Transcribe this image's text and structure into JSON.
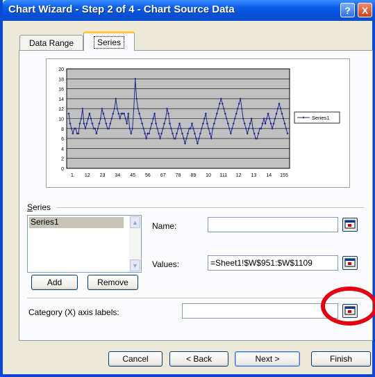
{
  "window": {
    "title": "Chart Wizard - Step 2 of 4 - Chart Source Data",
    "help": "?",
    "close": "X"
  },
  "tabs": [
    "Data Range",
    "Series"
  ],
  "chart_data": {
    "type": "line",
    "title": "",
    "ylim": [
      0,
      20
    ],
    "yticks": [
      0,
      2,
      4,
      6,
      8,
      10,
      12,
      14,
      16,
      18,
      20
    ],
    "x_tick_labels": [
      "1",
      "12",
      "23",
      "34",
      "45",
      "56",
      "67",
      "78",
      "89",
      "10",
      "111",
      "12",
      "13",
      "14",
      "155"
    ],
    "grid": true,
    "legend_position": "right",
    "series": [
      {
        "name": "Series1",
        "values": [
          11,
          9,
          8,
          7,
          8,
          8,
          7,
          7,
          9,
          10,
          12,
          9,
          8,
          9,
          10,
          11,
          10,
          9,
          8,
          8,
          7,
          8,
          9,
          10,
          12,
          11,
          10,
          9,
          8,
          8,
          9,
          10,
          11,
          12,
          14,
          12,
          11,
          10,
          11,
          11,
          11,
          10,
          9,
          11,
          8,
          7,
          8,
          12,
          18,
          14,
          12,
          11,
          10,
          9,
          8,
          7,
          6,
          7,
          7,
          8,
          9,
          10,
          11,
          9,
          8,
          7,
          6,
          7,
          8,
          9,
          10,
          12,
          11,
          9,
          8,
          7,
          6,
          6,
          7,
          8,
          9,
          8,
          7,
          6,
          5,
          6,
          7,
          8,
          8,
          9,
          8,
          7,
          6,
          5,
          6,
          7,
          8,
          9,
          10,
          11,
          9,
          8,
          7,
          6,
          8,
          9,
          10,
          11,
          12,
          13,
          14,
          13,
          12,
          11,
          10,
          9,
          8,
          7,
          8,
          9,
          10,
          11,
          12,
          13,
          14,
          12,
          10,
          9,
          8,
          7,
          8,
          9,
          10,
          8,
          7,
          6,
          6,
          7,
          8,
          8,
          9,
          10,
          9,
          10,
          11,
          10,
          9,
          8,
          9,
          10,
          11,
          12,
          13,
          12,
          11,
          10,
          9,
          8,
          7
        ]
      }
    ]
  },
  "series_section": {
    "label": "Series",
    "list_items": [
      "Series1"
    ],
    "add_button": "Add",
    "remove_button": "Remove"
  },
  "fields": {
    "name_label": "Name:",
    "name_value": "",
    "values_label": "Values:",
    "values_value": "=Sheet1!$W$951:$W$1109",
    "category_label": "Category (X) axis labels:",
    "category_value": ""
  },
  "footer": {
    "cancel": "Cancel",
    "back": "< Back",
    "next": "Next >",
    "finish": "Finish"
  },
  "colors": {
    "series_line": "#1c2a8c",
    "plot_bg": "#c0c0c0",
    "annotation_circle": "#e4000f"
  }
}
